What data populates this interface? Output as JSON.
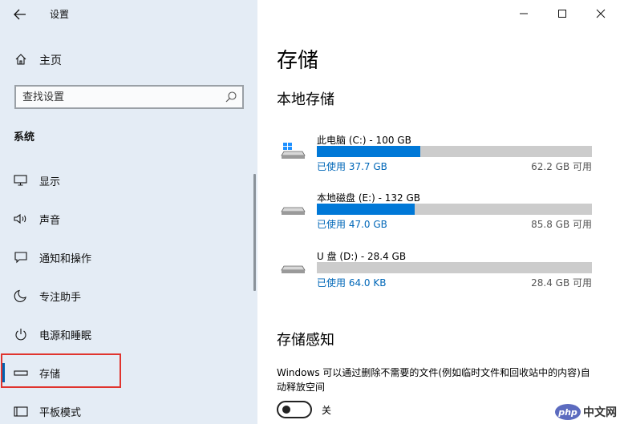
{
  "window": {
    "title": "设置"
  },
  "sidebar": {
    "home_label": "主页",
    "search": {
      "placeholder": "查找设置"
    },
    "section_label": "系统",
    "items": [
      {
        "label": "显示",
        "icon": "monitor-icon"
      },
      {
        "label": "声音",
        "icon": "speaker-icon"
      },
      {
        "label": "通知和操作",
        "icon": "notification-icon"
      },
      {
        "label": "专注助手",
        "icon": "moon-icon"
      },
      {
        "label": "电源和睡眠",
        "icon": "power-icon"
      },
      {
        "label": "存储",
        "icon": "storage-icon",
        "selected": true
      },
      {
        "label": "平板模式",
        "icon": "tablet-icon"
      }
    ]
  },
  "main": {
    "title": "存储",
    "local_storage_heading": "本地存储",
    "drives": [
      {
        "name": "此电脑 (C:) - 100 GB",
        "used": "已使用 37.7 GB",
        "available": "62.2 GB 可用",
        "used_fraction": 0.377,
        "icon": "windows-drive-icon"
      },
      {
        "name": "本地磁盘 (E:) - 132 GB",
        "used": "已使用 47.0 GB",
        "available": "85.8 GB 可用",
        "used_fraction": 0.356,
        "icon": "drive-icon"
      },
      {
        "name": "U 盘 (D:) - 28.4 GB",
        "used": "已使用 64.0 KB",
        "available": "28.4 GB 可用",
        "used_fraction": 0.0,
        "icon": "drive-icon"
      }
    ],
    "storage_sense_heading": "存储感知",
    "storage_sense_desc": "Windows 可以通过删除不需要的文件(例如临时文件和回收站中的内容)自动释放空间",
    "toggle_label": "关",
    "toggle_on": false
  },
  "watermark": {
    "logo": "php",
    "text": "中文网"
  },
  "colors": {
    "accent": "#0078d7",
    "sidebar_bg": "#e4ecf5",
    "highlight": "#e0342e"
  }
}
